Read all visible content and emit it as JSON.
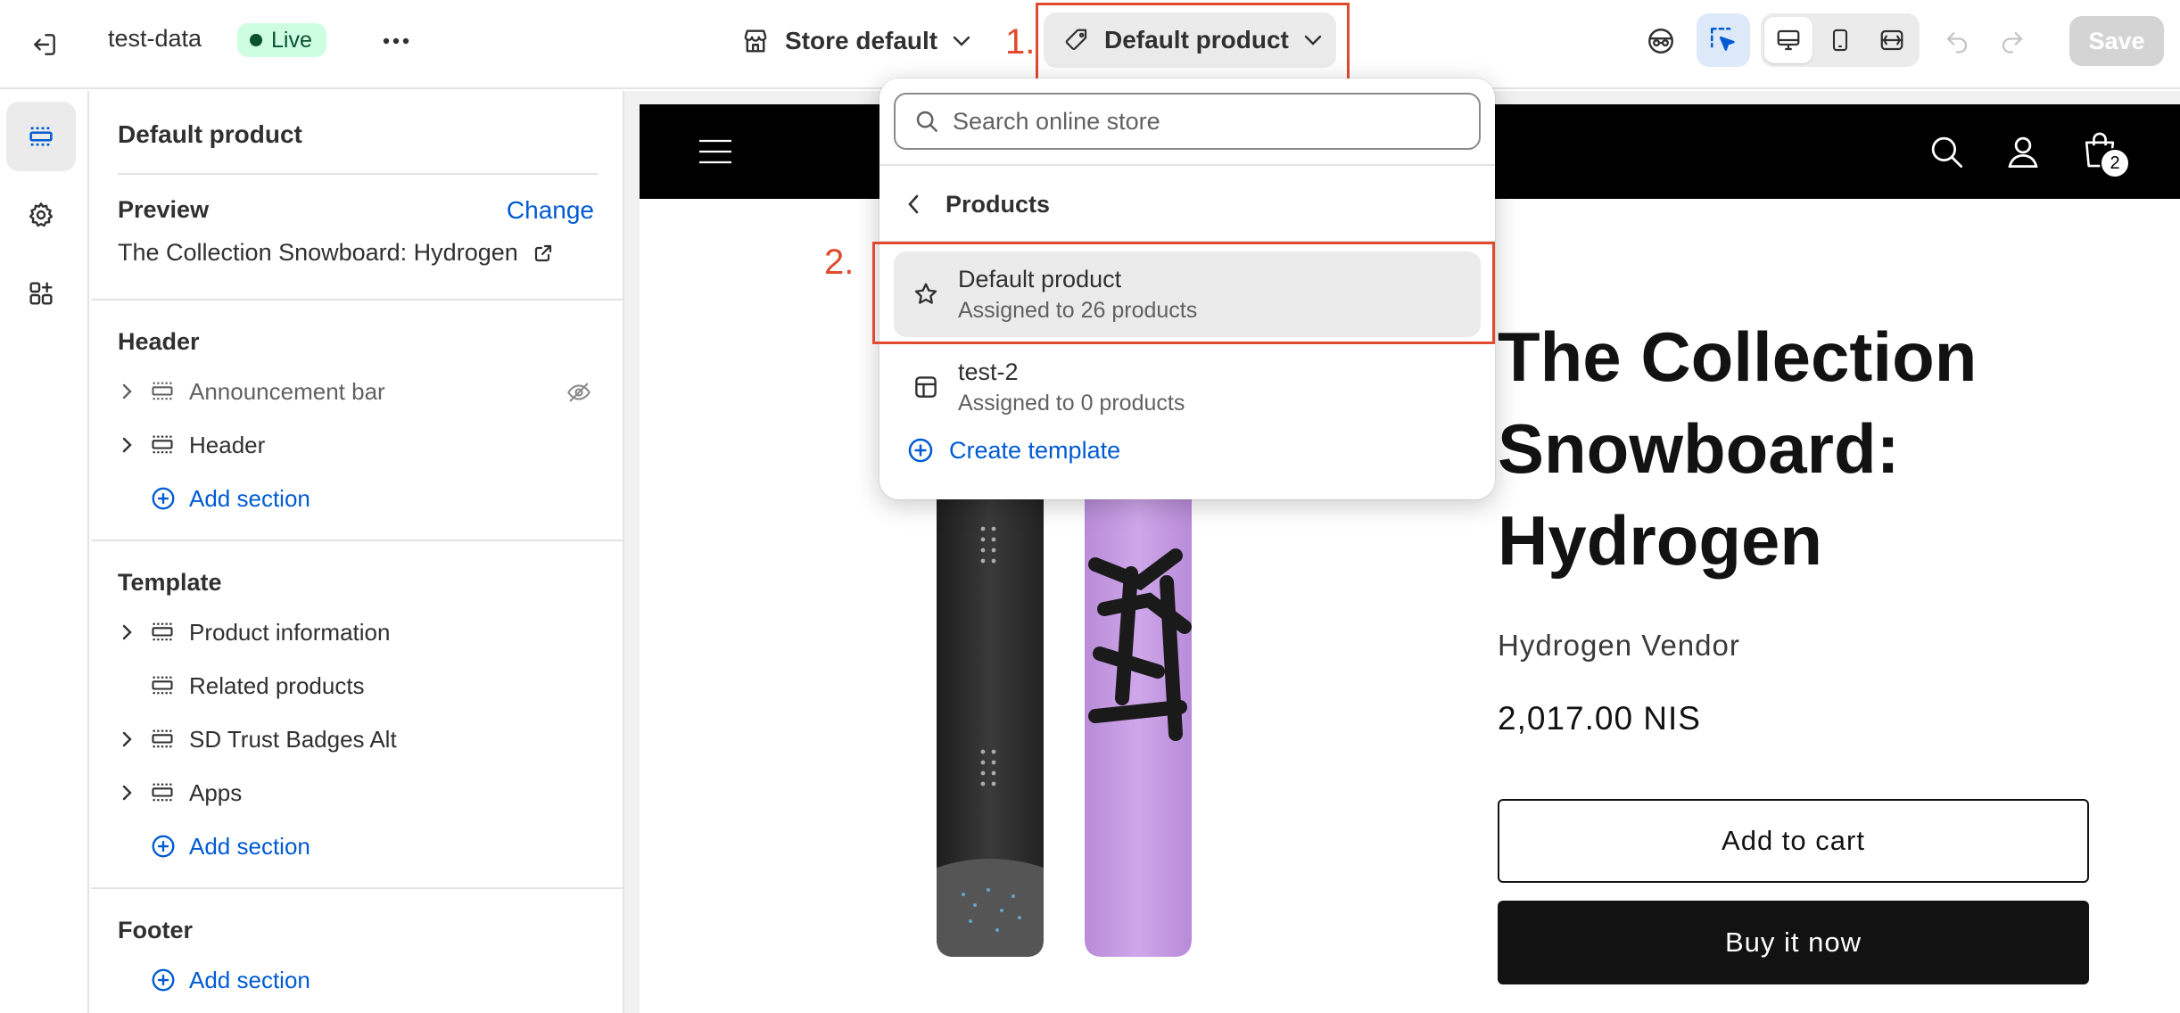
{
  "topbar": {
    "store_name": "test-data",
    "live_label": "Live",
    "store_default_label": "Store default",
    "template_picker_label": "Default product",
    "save_label": "Save"
  },
  "annotations": {
    "step1": "1.",
    "step2": "2.",
    "highlight_color": "#e04a2f"
  },
  "icons": {
    "exit": "exit-icon",
    "more": "more-icon",
    "store": "store-icon",
    "tag": "tag-icon",
    "inspector": "inspector-icon",
    "select": "select-cursor-icon",
    "desktop": "desktop-icon",
    "mobile": "mobile-icon",
    "fullscreen": "fullscreen-icon",
    "undo": "undo-icon",
    "redo": "redo-icon"
  },
  "rail": {
    "items": [
      "sections",
      "settings",
      "apps"
    ]
  },
  "panel": {
    "title": "Default product",
    "preview_heading": "Preview",
    "change_label": "Change",
    "preview_product": "The Collection Snowboard: Hydrogen",
    "header_group": {
      "heading": "Header",
      "items": [
        {
          "label": "Announcement bar",
          "hidden": true
        },
        {
          "label": "Header",
          "hidden": false
        }
      ],
      "add_section": "Add section"
    },
    "template_group": {
      "heading": "Template",
      "items": [
        {
          "label": "Product information",
          "expandable": true
        },
        {
          "label": "Related products",
          "expandable": false
        },
        {
          "label": "SD Trust Badges Alt",
          "expandable": true
        },
        {
          "label": "Apps",
          "expandable": true
        }
      ],
      "add_section": "Add section"
    },
    "footer_group": {
      "heading": "Footer",
      "add_section": "Add section"
    }
  },
  "popover": {
    "search_placeholder": "Search online store",
    "back_label": "Products",
    "templates": [
      {
        "name": "Default product",
        "assigned": "Assigned to 26 products",
        "selected": true
      },
      {
        "name": "test-2",
        "assigned": "Assigned to 0 products",
        "selected": false
      }
    ],
    "create_label": "Create template"
  },
  "storefront": {
    "cart_count": "2",
    "product_title": "The Collection Snowboard: Hydrogen",
    "vendor": "Hydrogen Vendor",
    "price": "2,017.00 NIS",
    "add_to_cart": "Add to cart",
    "buy_now": "Buy it now"
  },
  "colors": {
    "accent_link": "#005bd3",
    "live_badge_bg": "#cdfee1",
    "live_badge_text": "#0c5132",
    "board_dark": "#2b2b2b",
    "board_purple": "#c49ee0"
  }
}
